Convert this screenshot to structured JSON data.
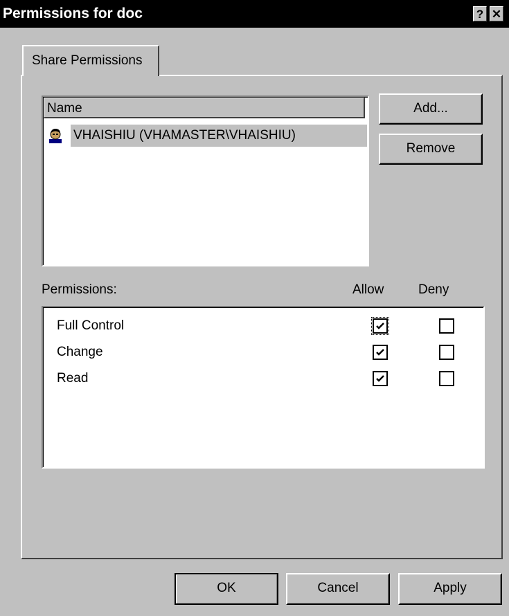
{
  "window": {
    "title": "Permissions for doc",
    "help_label": "?",
    "close_label": "✕"
  },
  "tabs": [
    {
      "label": "Share Permissions",
      "selected": true
    }
  ],
  "users_list": {
    "header": "Name",
    "items": [
      {
        "name": "VHAISHIU (VHAMASTER\\VHAISHIU)",
        "icon": "user-icon",
        "selected": true
      }
    ]
  },
  "buttons": {
    "add": "Add...",
    "remove": "Remove",
    "ok": "OK",
    "cancel": "Cancel",
    "apply": "Apply"
  },
  "permissions": {
    "label": "Permissions:",
    "allow_header": "Allow",
    "deny_header": "Deny",
    "rows": [
      {
        "name": "Full Control",
        "allow": true,
        "deny": false
      },
      {
        "name": "Change",
        "allow": true,
        "deny": false
      },
      {
        "name": "Read",
        "allow": true,
        "deny": false
      }
    ]
  },
  "colors": {
    "title_bar": "#000000",
    "face": "#c0c0c0",
    "selection": "#c0c0c0",
    "window_bg": "#ffffff"
  }
}
